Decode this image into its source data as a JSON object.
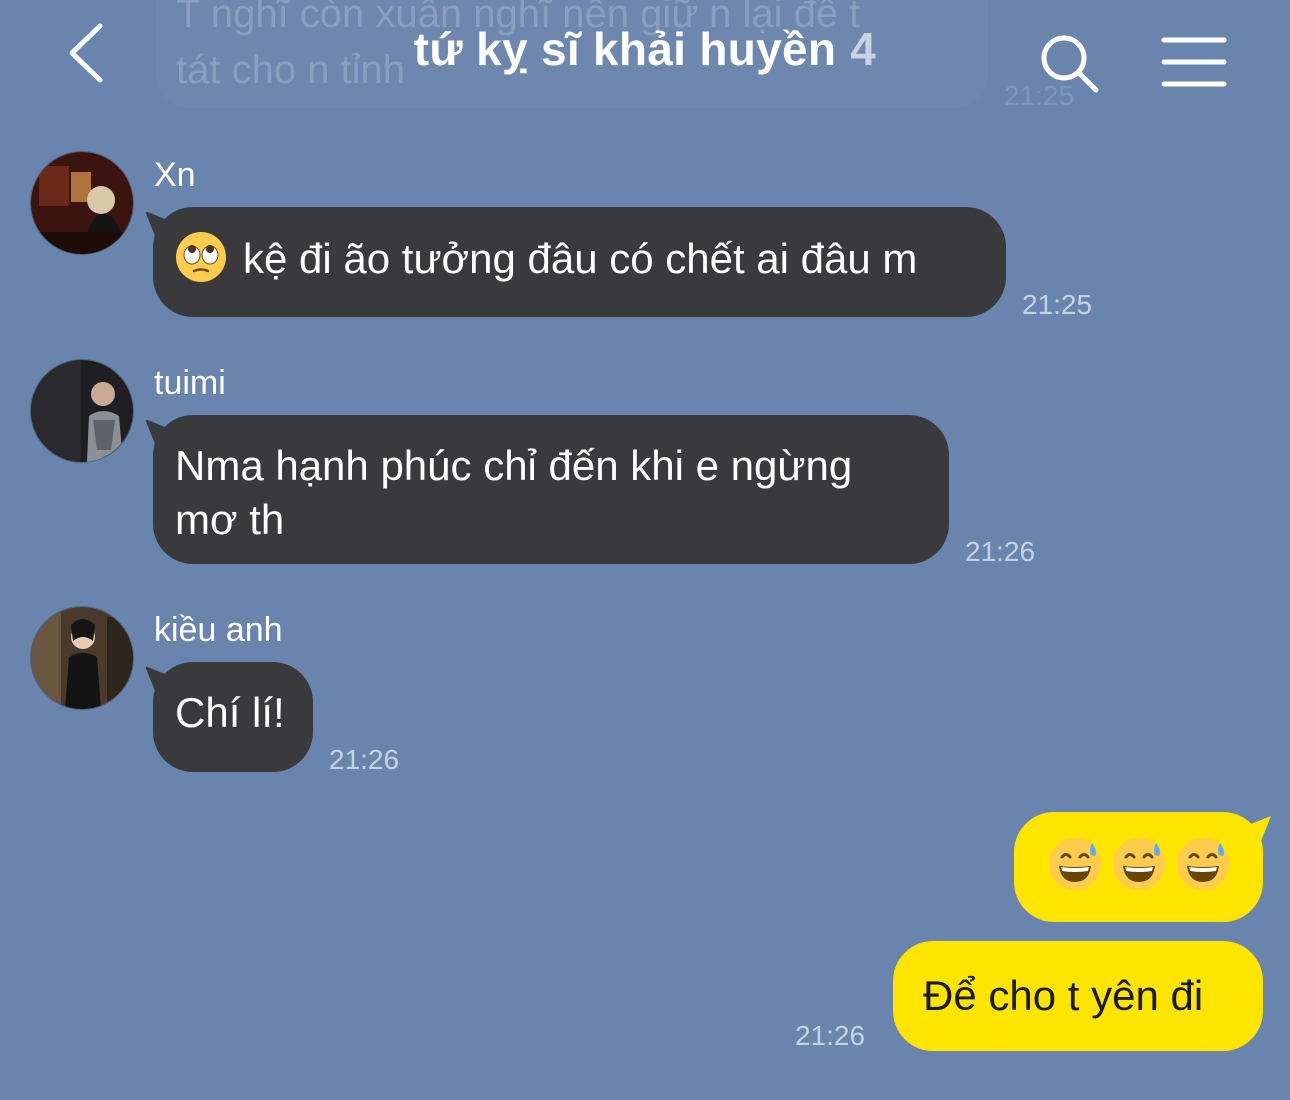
{
  "header": {
    "title": "tứ kỵ sĩ khải huyền",
    "member_count": "4",
    "back_icon": "chevron-left-icon",
    "search_icon": "search-icon",
    "menu_icon": "hamburger-menu-icon"
  },
  "previous_message": {
    "text": "T nghĩ còn xuân nghĩ nên giữ n lại để t\ntát cho n tỉnh",
    "time": "21:25"
  },
  "messages": [
    {
      "sender": "Xn",
      "text": "kệ đi ão tưởng đâu có chết ai đâu m",
      "emoji": "face-with-rolling-eyes",
      "time": "21:25"
    },
    {
      "sender": "tuimi",
      "text": "Nma hạnh phúc chỉ đến khi e ngừng mơ th",
      "time": "21:26"
    },
    {
      "sender": "kiều anh",
      "text": "Chí lí!",
      "time": "21:26"
    }
  ],
  "outgoing": [
    {
      "emojis": [
        "grinning-face-with-sweat",
        "grinning-face-with-sweat",
        "grinning-face-with-sweat"
      ]
    },
    {
      "text": "Để cho t yên đi",
      "time": "21:26"
    }
  ],
  "colors": {
    "background": "#6a85ad",
    "incoming_bubble": "#3a3a3c",
    "outgoing_bubble": "#fee500"
  }
}
